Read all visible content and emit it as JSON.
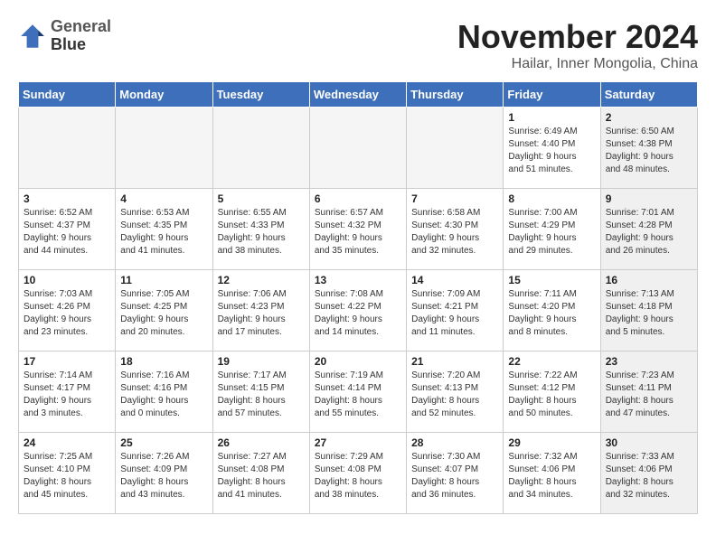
{
  "logo": {
    "line1": "General",
    "line2": "Blue"
  },
  "title": "November 2024",
  "location": "Hailar, Inner Mongolia, China",
  "days_of_week": [
    "Sunday",
    "Monday",
    "Tuesday",
    "Wednesday",
    "Thursday",
    "Friday",
    "Saturday"
  ],
  "weeks": [
    [
      {
        "day": "",
        "info": "",
        "shaded": true
      },
      {
        "day": "",
        "info": "",
        "shaded": true
      },
      {
        "day": "",
        "info": "",
        "shaded": true
      },
      {
        "day": "",
        "info": "",
        "shaded": true
      },
      {
        "day": "",
        "info": "",
        "shaded": true
      },
      {
        "day": "1",
        "info": "Sunrise: 6:49 AM\nSunset: 4:40 PM\nDaylight: 9 hours\nand 51 minutes.",
        "shaded": false
      },
      {
        "day": "2",
        "info": "Sunrise: 6:50 AM\nSunset: 4:38 PM\nDaylight: 9 hours\nand 48 minutes.",
        "shaded": true
      }
    ],
    [
      {
        "day": "3",
        "info": "Sunrise: 6:52 AM\nSunset: 4:37 PM\nDaylight: 9 hours\nand 44 minutes.",
        "shaded": false
      },
      {
        "day": "4",
        "info": "Sunrise: 6:53 AM\nSunset: 4:35 PM\nDaylight: 9 hours\nand 41 minutes.",
        "shaded": false
      },
      {
        "day": "5",
        "info": "Sunrise: 6:55 AM\nSunset: 4:33 PM\nDaylight: 9 hours\nand 38 minutes.",
        "shaded": false
      },
      {
        "day": "6",
        "info": "Sunrise: 6:57 AM\nSunset: 4:32 PM\nDaylight: 9 hours\nand 35 minutes.",
        "shaded": false
      },
      {
        "day": "7",
        "info": "Sunrise: 6:58 AM\nSunset: 4:30 PM\nDaylight: 9 hours\nand 32 minutes.",
        "shaded": false
      },
      {
        "day": "8",
        "info": "Sunrise: 7:00 AM\nSunset: 4:29 PM\nDaylight: 9 hours\nand 29 minutes.",
        "shaded": false
      },
      {
        "day": "9",
        "info": "Sunrise: 7:01 AM\nSunset: 4:28 PM\nDaylight: 9 hours\nand 26 minutes.",
        "shaded": true
      }
    ],
    [
      {
        "day": "10",
        "info": "Sunrise: 7:03 AM\nSunset: 4:26 PM\nDaylight: 9 hours\nand 23 minutes.",
        "shaded": false
      },
      {
        "day": "11",
        "info": "Sunrise: 7:05 AM\nSunset: 4:25 PM\nDaylight: 9 hours\nand 20 minutes.",
        "shaded": false
      },
      {
        "day": "12",
        "info": "Sunrise: 7:06 AM\nSunset: 4:23 PM\nDaylight: 9 hours\nand 17 minutes.",
        "shaded": false
      },
      {
        "day": "13",
        "info": "Sunrise: 7:08 AM\nSunset: 4:22 PM\nDaylight: 9 hours\nand 14 minutes.",
        "shaded": false
      },
      {
        "day": "14",
        "info": "Sunrise: 7:09 AM\nSunset: 4:21 PM\nDaylight: 9 hours\nand 11 minutes.",
        "shaded": false
      },
      {
        "day": "15",
        "info": "Sunrise: 7:11 AM\nSunset: 4:20 PM\nDaylight: 9 hours\nand 8 minutes.",
        "shaded": false
      },
      {
        "day": "16",
        "info": "Sunrise: 7:13 AM\nSunset: 4:18 PM\nDaylight: 9 hours\nand 5 minutes.",
        "shaded": true
      }
    ],
    [
      {
        "day": "17",
        "info": "Sunrise: 7:14 AM\nSunset: 4:17 PM\nDaylight: 9 hours\nand 3 minutes.",
        "shaded": false
      },
      {
        "day": "18",
        "info": "Sunrise: 7:16 AM\nSunset: 4:16 PM\nDaylight: 9 hours\nand 0 minutes.",
        "shaded": false
      },
      {
        "day": "19",
        "info": "Sunrise: 7:17 AM\nSunset: 4:15 PM\nDaylight: 8 hours\nand 57 minutes.",
        "shaded": false
      },
      {
        "day": "20",
        "info": "Sunrise: 7:19 AM\nSunset: 4:14 PM\nDaylight: 8 hours\nand 55 minutes.",
        "shaded": false
      },
      {
        "day": "21",
        "info": "Sunrise: 7:20 AM\nSunset: 4:13 PM\nDaylight: 8 hours\nand 52 minutes.",
        "shaded": false
      },
      {
        "day": "22",
        "info": "Sunrise: 7:22 AM\nSunset: 4:12 PM\nDaylight: 8 hours\nand 50 minutes.",
        "shaded": false
      },
      {
        "day": "23",
        "info": "Sunrise: 7:23 AM\nSunset: 4:11 PM\nDaylight: 8 hours\nand 47 minutes.",
        "shaded": true
      }
    ],
    [
      {
        "day": "24",
        "info": "Sunrise: 7:25 AM\nSunset: 4:10 PM\nDaylight: 8 hours\nand 45 minutes.",
        "shaded": false
      },
      {
        "day": "25",
        "info": "Sunrise: 7:26 AM\nSunset: 4:09 PM\nDaylight: 8 hours\nand 43 minutes.",
        "shaded": false
      },
      {
        "day": "26",
        "info": "Sunrise: 7:27 AM\nSunset: 4:08 PM\nDaylight: 8 hours\nand 41 minutes.",
        "shaded": false
      },
      {
        "day": "27",
        "info": "Sunrise: 7:29 AM\nSunset: 4:08 PM\nDaylight: 8 hours\nand 38 minutes.",
        "shaded": false
      },
      {
        "day": "28",
        "info": "Sunrise: 7:30 AM\nSunset: 4:07 PM\nDaylight: 8 hours\nand 36 minutes.",
        "shaded": false
      },
      {
        "day": "29",
        "info": "Sunrise: 7:32 AM\nSunset: 4:06 PM\nDaylight: 8 hours\nand 34 minutes.",
        "shaded": false
      },
      {
        "day": "30",
        "info": "Sunrise: 7:33 AM\nSunset: 4:06 PM\nDaylight: 8 hours\nand 32 minutes.",
        "shaded": true
      }
    ]
  ]
}
